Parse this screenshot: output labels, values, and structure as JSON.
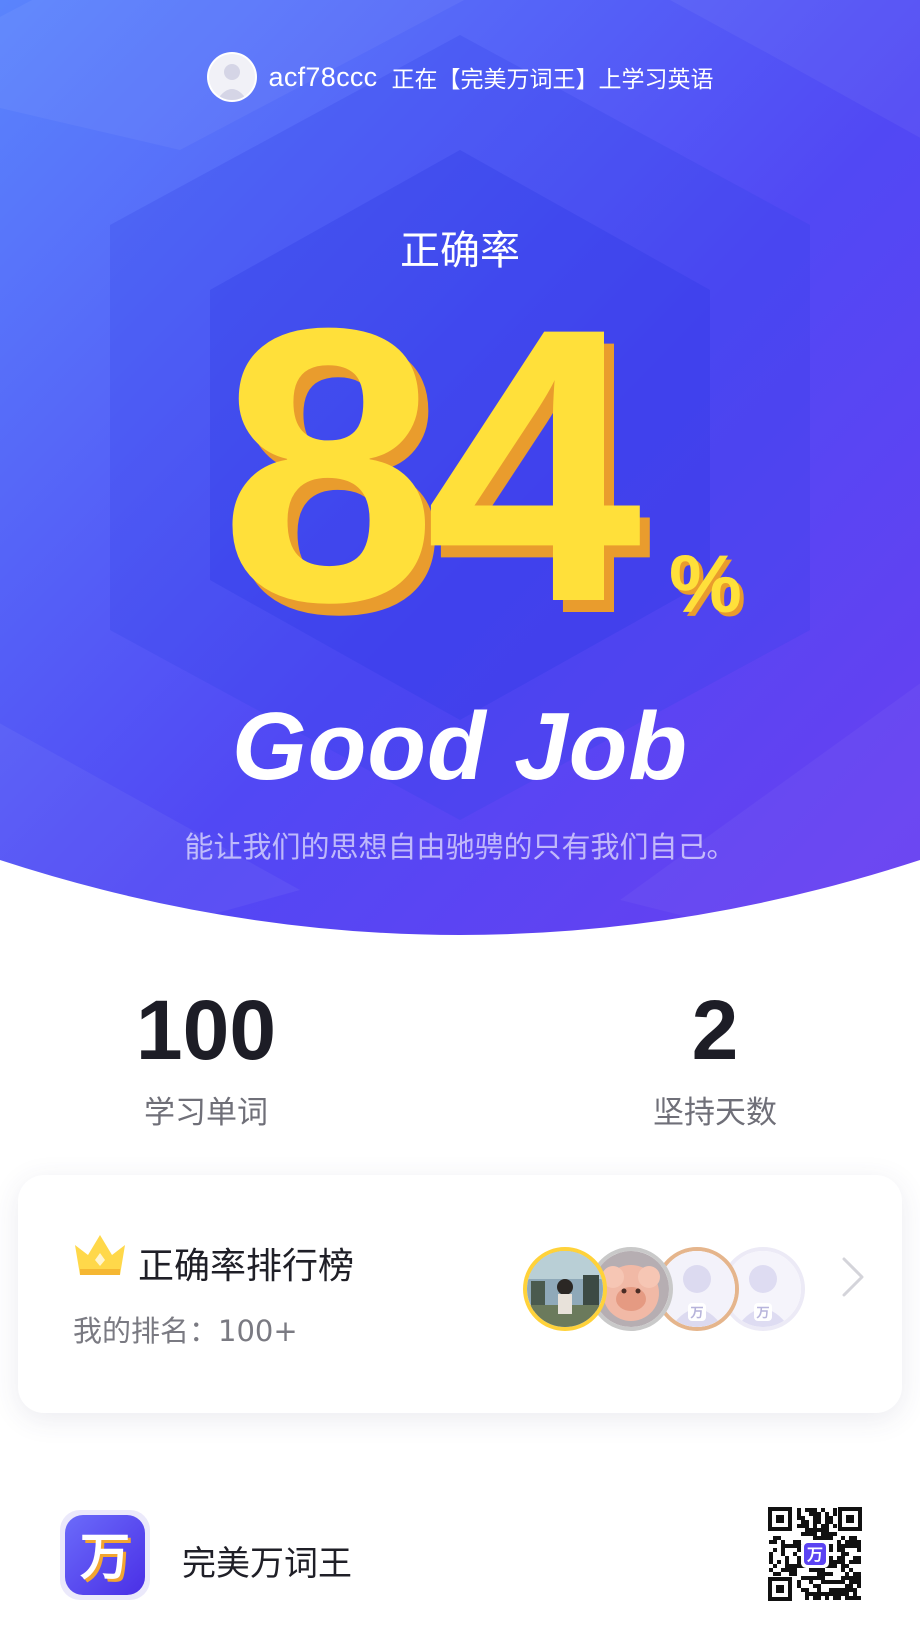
{
  "header": {
    "username": "acf78ccc",
    "studying_text": "正在【完美万词王】上学习英语"
  },
  "result": {
    "accuracy_label": "正确率",
    "accuracy_value": "84",
    "percent_sign": "%",
    "headline": "Good Job",
    "quote": "能让我们的思想自由驰骋的只有我们自己。"
  },
  "stats": {
    "words_count": "100",
    "words_label": "学习单词",
    "days_count": "2",
    "days_label": "坚持天数"
  },
  "ranking": {
    "title": "正确率排行榜",
    "my_rank": "我的排名：100+",
    "avatar_brand_char": "万"
  },
  "footer": {
    "app_name": "完美万词王",
    "logo_char": "万",
    "qr_center_char": "万"
  },
  "colors": {
    "hero_gradient_start": "#5a83fb",
    "hero_gradient_end": "#6b3ef3",
    "number_yellow": "#ffe03a",
    "number_shadow": "#e99c2d",
    "brand_purple": "#5b43f2"
  },
  "icons": {
    "crown": "crown-icon",
    "chevron": "chevron-right-icon",
    "qr": "qr-code-icon"
  }
}
